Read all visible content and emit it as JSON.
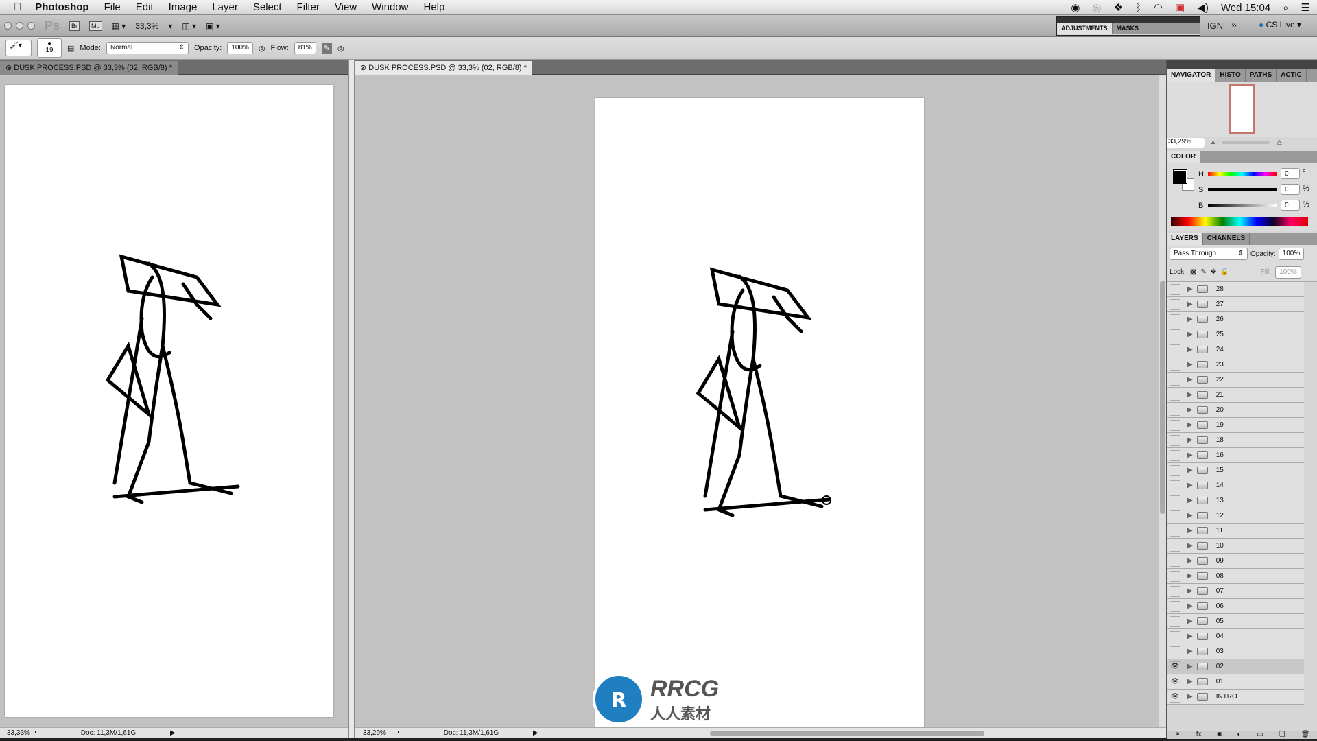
{
  "menubar": {
    "app": "Photoshop",
    "items": [
      "File",
      "Edit",
      "Image",
      "Layer",
      "Select",
      "Filter",
      "View",
      "Window",
      "Help"
    ],
    "clock": "Wed 15:04"
  },
  "appbar": {
    "ps": "Ps",
    "br": "Br",
    "mb": "Mb",
    "zoom": "33,3%",
    "workspace": "IGN",
    "cs_live": "CS Live"
  },
  "options": {
    "brush_size": "19",
    "mode_label": "Mode:",
    "mode": "Normal",
    "opacity_label": "Opacity:",
    "opacity": "100%",
    "flow_label": "Flow:",
    "flow": "81%"
  },
  "adjustments_panel": {
    "tabs": [
      "ADJUSTMENTS",
      "MASKS"
    ]
  },
  "documents": [
    {
      "tab": "DUSK PROCESS.PSD @ 33,3% (02, RGB/8) *",
      "zoom": "33,33%",
      "doc": "Doc: 11,3M/1,61G"
    },
    {
      "tab": "DUSK PROCESS.PSD @ 33,3% (02, RGB/8) *",
      "zoom": "33,29%",
      "doc": "Doc: 11,3M/1,61G"
    }
  ],
  "navigator": {
    "tabs": [
      "NAVIGATOR",
      "HISTO",
      "PATHS",
      "ACTIC"
    ],
    "zoom": "33,29%"
  },
  "color": {
    "tab": "COLOR",
    "h_label": "H",
    "s_label": "S",
    "b_label": "B",
    "h": "0",
    "s": "0",
    "b": "0",
    "h_unit": "°",
    "s_unit": "%",
    "b_unit": "%",
    "foreground": "#000000",
    "background": "#ffffff"
  },
  "layers": {
    "tabs": [
      "LAYERS",
      "CHANNELS"
    ],
    "blend": "Pass Through",
    "opacity_label": "Opacity:",
    "opacity": "100%",
    "lock_label": "Lock:",
    "fill_label": "Fill:",
    "fill": "100%",
    "items": [
      {
        "name": "28",
        "visible": false
      },
      {
        "name": "27",
        "visible": false
      },
      {
        "name": "26",
        "visible": false
      },
      {
        "name": "25",
        "visible": false
      },
      {
        "name": "24",
        "visible": false
      },
      {
        "name": "23",
        "visible": false
      },
      {
        "name": "22",
        "visible": false
      },
      {
        "name": "21",
        "visible": false
      },
      {
        "name": "20",
        "visible": false
      },
      {
        "name": "19",
        "visible": false
      },
      {
        "name": "18",
        "visible": false
      },
      {
        "name": "16",
        "visible": false
      },
      {
        "name": "15",
        "visible": false
      },
      {
        "name": "14",
        "visible": false
      },
      {
        "name": "13",
        "visible": false
      },
      {
        "name": "12",
        "visible": false
      },
      {
        "name": "11",
        "visible": false
      },
      {
        "name": "10",
        "visible": false
      },
      {
        "name": "09",
        "visible": false
      },
      {
        "name": "08",
        "visible": false
      },
      {
        "name": "07",
        "visible": false
      },
      {
        "name": "06",
        "visible": false
      },
      {
        "name": "05",
        "visible": false
      },
      {
        "name": "04",
        "visible": false
      },
      {
        "name": "03",
        "visible": false
      },
      {
        "name": "02",
        "visible": true,
        "selected": true
      },
      {
        "name": "01",
        "visible": true
      },
      {
        "name": "INTRO",
        "visible": true
      }
    ]
  },
  "watermark": {
    "text": "RRCG",
    "subtext": "人人素材"
  }
}
